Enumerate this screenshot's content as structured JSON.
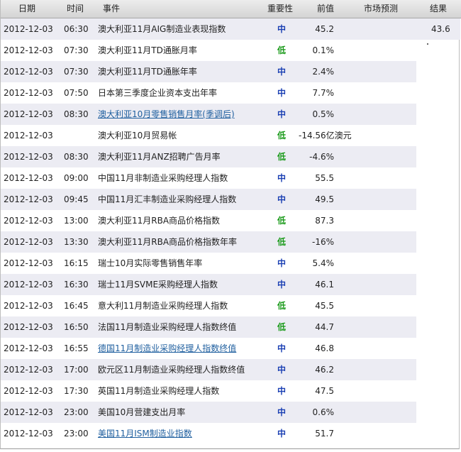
{
  "header": {
    "date": "日期",
    "time": "时间",
    "event": "事件",
    "importance": "重要性",
    "previous": "前值",
    "forecast": "市场预测",
    "result": "结果"
  },
  "colors": {
    "importance_mid": "#1a3fb3",
    "importance_low": "#1a9a1a",
    "link": "#1f5f9f",
    "row_alt": "#ececf3"
  },
  "rows": [
    {
      "date": "2012-12-03",
      "time": "06:30",
      "event": "澳大利亚11月AIG制造业表现指数",
      "importance": "中",
      "previous": "45.2",
      "result": "43.6"
    },
    {
      "date": "2012-12-03",
      "time": "07:30",
      "event": "澳大利亚11月TD通胀月率",
      "importance": "低",
      "previous": "0.1%"
    },
    {
      "date": "2012-12-03",
      "time": "07:30",
      "event": "澳大利亚11月TD通胀年率",
      "importance": "中",
      "previous": "2.4%"
    },
    {
      "date": "2012-12-03",
      "time": "07:50",
      "event": "日本第三季度企业资本支出年率",
      "importance": "中",
      "previous": "7.7%"
    },
    {
      "date": "2012-12-03",
      "time": "08:30",
      "event": "澳大利亚10月零售销售月率(季调后)",
      "importance": "中",
      "previous": "0.5%"
    },
    {
      "date": "2012-12-03",
      "time": "",
      "event": "澳大利亚10月贸易帐",
      "importance": "低",
      "previous": "-14.56亿澳元"
    },
    {
      "date": "2012-12-03",
      "time": "08:30",
      "event": "澳大利亚11月ANZ招聘广告月率",
      "importance": "低",
      "previous": "-4.6%"
    },
    {
      "date": "2012-12-03",
      "time": "09:00",
      "event": "中国11月非制造业采购经理人指数",
      "importance": "中",
      "previous": "55.5"
    },
    {
      "date": "2012-12-03",
      "time": "09:45",
      "event": "中国11月汇丰制造业采购经理人指数",
      "importance": "中",
      "previous": "49.5"
    },
    {
      "date": "2012-12-03",
      "time": "13:00",
      "event": "澳大利亚11月RBA商品价格指数",
      "importance": "低",
      "previous": "87.3"
    },
    {
      "date": "2012-12-03",
      "time": "13:30",
      "event": "澳大利亚11月RBA商品价格指数年率",
      "importance": "低",
      "previous": "-16%"
    },
    {
      "date": "2012-12-03",
      "time": "16:15",
      "event": "瑞士10月实际零售销售年率",
      "importance": "中",
      "previous": "5.4%"
    },
    {
      "date": "2012-12-03",
      "time": "16:30",
      "event": "瑞士11月SVME采购经理人指数",
      "importance": "中",
      "previous": "46.1"
    },
    {
      "date": "2012-12-03",
      "time": "16:45",
      "event": "意大利11月制造业采购经理人指数",
      "importance": "低",
      "previous": "45.5"
    },
    {
      "date": "2012-12-03",
      "time": "16:50",
      "event": "法国11月制造业采购经理人指数终值",
      "importance": "低",
      "previous": "44.7"
    },
    {
      "date": "2012-12-03",
      "time": "16:55",
      "event": "德国11月制造业采购经理人指数终值",
      "importance": "中",
      "previous": "46.8"
    },
    {
      "date": "2012-12-03",
      "time": "17:00",
      "event": "欧元区11月制造业采购经理人指数终值",
      "importance": "中",
      "previous": "46.2"
    },
    {
      "date": "2012-12-03",
      "time": "17:30",
      "event": "英国11月制造业采购经理人指数",
      "importance": "中",
      "previous": "47.5"
    },
    {
      "date": "2012-12-03",
      "time": "23:00",
      "event": "美国10月营建支出月率",
      "importance": "中",
      "previous": "0.6%"
    },
    {
      "date": "2012-12-03",
      "time": "23:00",
      "event": "美国11月ISM制造业指数",
      "importance": "中",
      "previous": "51.7"
    }
  ]
}
